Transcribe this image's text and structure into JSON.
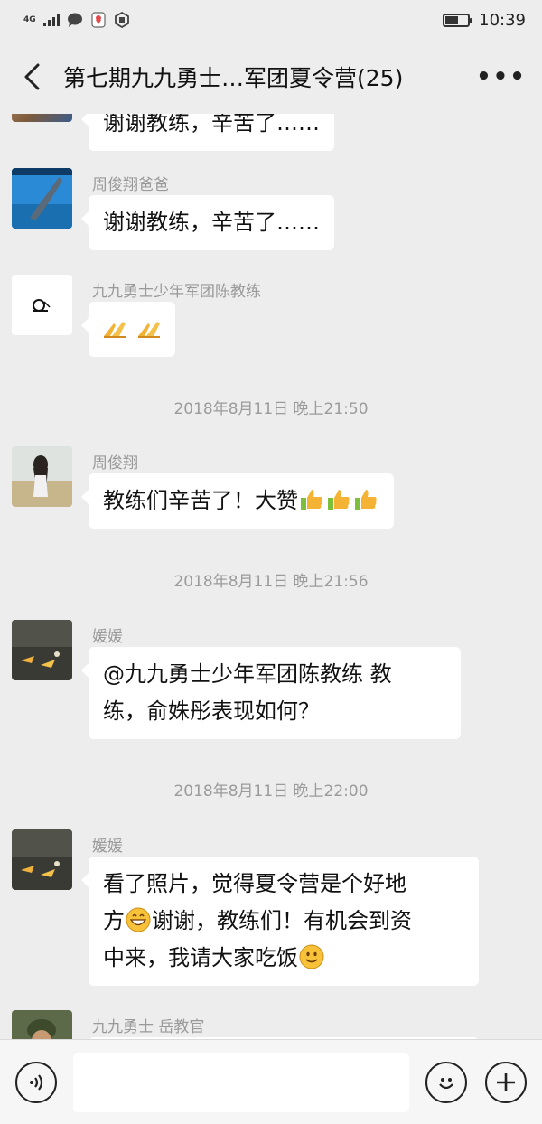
{
  "status": {
    "network": "4G",
    "time": "10:39",
    "battery_level": 0.55
  },
  "header": {
    "title": "第七期九九勇士…军团夏令营(25)",
    "back_icon": "back-arrow-icon",
    "more_icon": "more-dots-icon",
    "more_label": "•••"
  },
  "messages": [
    {
      "text": "谢谢教练，辛苦了……"
    },
    {
      "sender": "周俊翔爸爸",
      "text": "谢谢教练，辛苦了……"
    },
    {
      "sender": "九九勇士少年军团陈教练",
      "emojis": [
        "pray-hands-emoji",
        "pray-hands-emoji"
      ]
    },
    {
      "sender": "周俊翔",
      "text": "教练们辛苦了！大赞",
      "emojis": [
        "thumbs-up-emoji",
        "thumbs-up-emoji",
        "thumbs-up-emoji"
      ]
    },
    {
      "sender": "媛媛",
      "line1": "@九九勇士少年军团陈教练  教",
      "line2": "练，俞姝彤表现如何？"
    },
    {
      "sender": "媛媛",
      "line1": "看了照片，觉得夏令营是个好地",
      "line2a": "方",
      "line2b": "谢谢，教练们！有机会到资",
      "line3": "中来，我请大家吃饭"
    },
    {
      "sender": "九九勇士  岳教官"
    }
  ],
  "timestamps": [
    "2018年8月11日 晚上21:50",
    "2018年8月11日 晚上21:56",
    "2018年8月11日 晚上22:00"
  ],
  "input": {
    "voice_icon": "voice-icon",
    "emoji_icon": "emoji-icon",
    "plus_icon": "plus-icon"
  }
}
